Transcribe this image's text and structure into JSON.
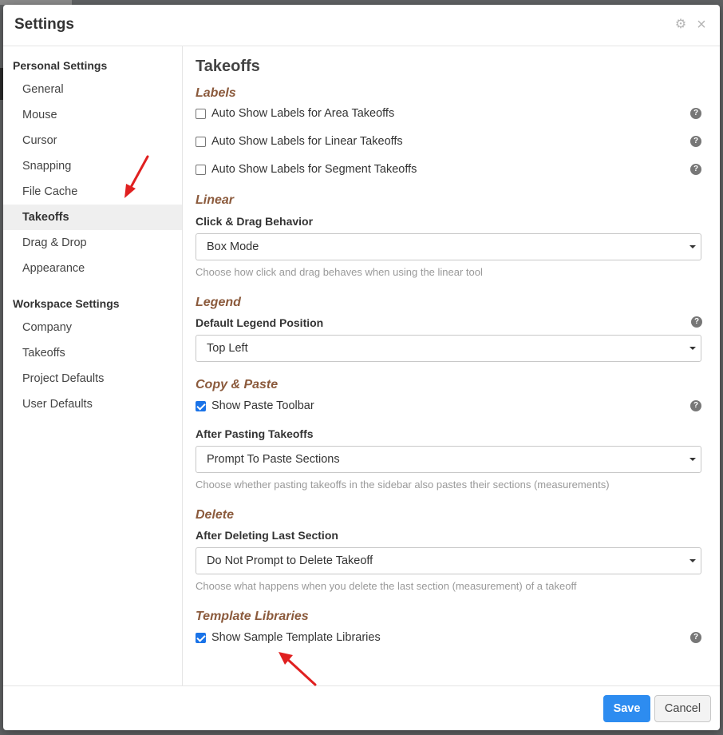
{
  "modal": {
    "title": "Settings"
  },
  "sidebar": {
    "personal_heading": "Personal Settings",
    "personal_items": [
      {
        "label": "General"
      },
      {
        "label": "Mouse"
      },
      {
        "label": "Cursor"
      },
      {
        "label": "Snapping"
      },
      {
        "label": "File Cache"
      },
      {
        "label": "Takeoffs",
        "active": true
      },
      {
        "label": "Drag & Drop"
      },
      {
        "label": "Appearance"
      }
    ],
    "workspace_heading": "Workspace Settings",
    "workspace_items": [
      {
        "label": "Company"
      },
      {
        "label": "Takeoffs"
      },
      {
        "label": "Project Defaults"
      },
      {
        "label": "User Defaults"
      }
    ]
  },
  "content": {
    "title": "Takeoffs",
    "labels": {
      "title": "Labels",
      "options": [
        {
          "label": "Auto Show Labels for Area Takeoffs",
          "checked": false
        },
        {
          "label": "Auto Show Labels for Linear Takeoffs",
          "checked": false
        },
        {
          "label": "Auto Show Labels for Segment Takeoffs",
          "checked": false
        }
      ]
    },
    "linear": {
      "title": "Linear",
      "field_label": "Click & Drag Behavior",
      "value": "Box Mode",
      "hint": "Choose how click and drag behaves when using the linear tool"
    },
    "legend": {
      "title": "Legend",
      "field_label": "Default Legend Position",
      "value": "Top Left"
    },
    "copy_paste": {
      "title": "Copy & Paste",
      "show_toolbar": {
        "label": "Show Paste Toolbar",
        "checked": true
      },
      "field_label": "After Pasting Takeoffs",
      "value": "Prompt To Paste Sections",
      "hint": "Choose whether pasting takeoffs in the sidebar also pastes their sections (measurements)"
    },
    "delete": {
      "title": "Delete",
      "field_label": "After Deleting Last Section",
      "value": "Do Not Prompt to Delete Takeoff",
      "hint": "Choose what happens when you delete the last section (measurement) of a takeoff"
    },
    "template_libraries": {
      "title": "Template Libraries",
      "show_samples": {
        "label": "Show Sample Template Libraries",
        "checked": true
      }
    },
    "help_glyph": "?"
  },
  "footer": {
    "save_label": "Save",
    "cancel_label": "Cancel"
  },
  "icons": {
    "gear": "gear-icon",
    "close": "close-icon",
    "caret": "chevron-down-icon",
    "help": "help-icon"
  },
  "colors": {
    "section_title": "#8b5a3c",
    "primary": "#2d8cf0",
    "annotation_arrow": "#e02020"
  }
}
